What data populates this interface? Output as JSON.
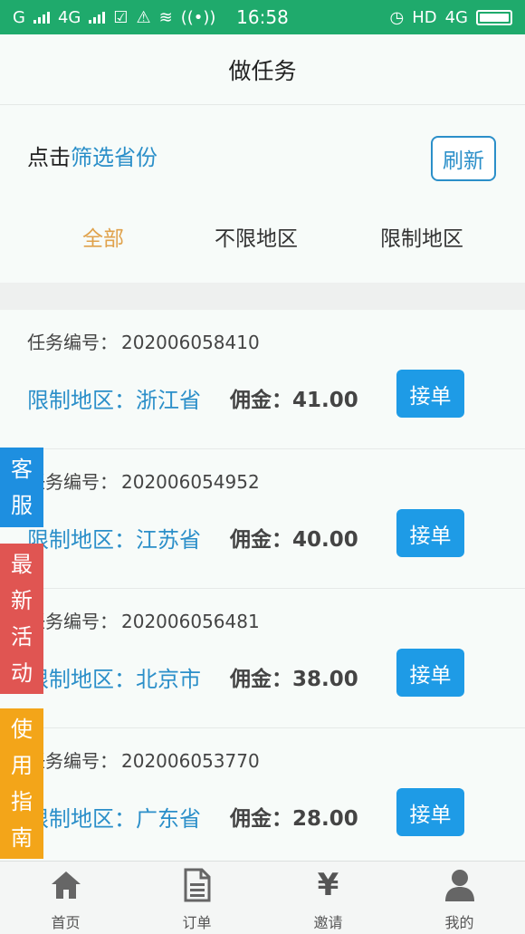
{
  "status_bar": {
    "carrier1": "G",
    "carrier2": "4G",
    "time": "16:58",
    "hd": "HD",
    "net": "4G"
  },
  "header": {
    "title": "做任务"
  },
  "filter": {
    "prefix": "点击",
    "link": "筛选省份",
    "refresh_label": "刷新",
    "tabs": [
      {
        "label": "全部",
        "active": true
      },
      {
        "label": "不限地区",
        "active": false
      },
      {
        "label": "限制地区",
        "active": false
      }
    ]
  },
  "tasks": [
    {
      "id_label": "任务编号：",
      "id": "202006058410",
      "region": "限制地区：浙江省",
      "commission": "佣金：41.00",
      "button": "接单"
    },
    {
      "id_label": "任务编号：",
      "id": "202006054952",
      "region": "限制地区：江苏省",
      "commission": "佣金：40.00",
      "button": "接单"
    },
    {
      "id_label": "任务编号：",
      "id": "202006056481",
      "region": "限制地区：北京市",
      "commission": "佣金：38.00",
      "button": "接单"
    },
    {
      "id_label": "任务编号：",
      "id": "202006053770",
      "region": "限制地区：广东省",
      "commission": "佣金：28.00",
      "button": "接单"
    }
  ],
  "side": {
    "service": [
      "客",
      "服"
    ],
    "activity": [
      "最",
      "新",
      "活",
      "动"
    ],
    "guide": [
      "使",
      "用",
      "指",
      "南"
    ]
  },
  "bottom_nav": [
    {
      "label": "首页",
      "icon": "home-icon"
    },
    {
      "label": "订单",
      "icon": "document-icon"
    },
    {
      "label": "邀请",
      "icon": "yen-icon"
    },
    {
      "label": "我的",
      "icon": "user-icon"
    }
  ],
  "yen_symbol": "¥",
  "colors": {
    "status_bar": "#1faa6c",
    "link": "#2b8fc9",
    "active_tab": "#e0a24c",
    "accept": "#1e9be6",
    "service": "#1e8fe0",
    "activity": "#e05552",
    "guide": "#f3a519"
  }
}
